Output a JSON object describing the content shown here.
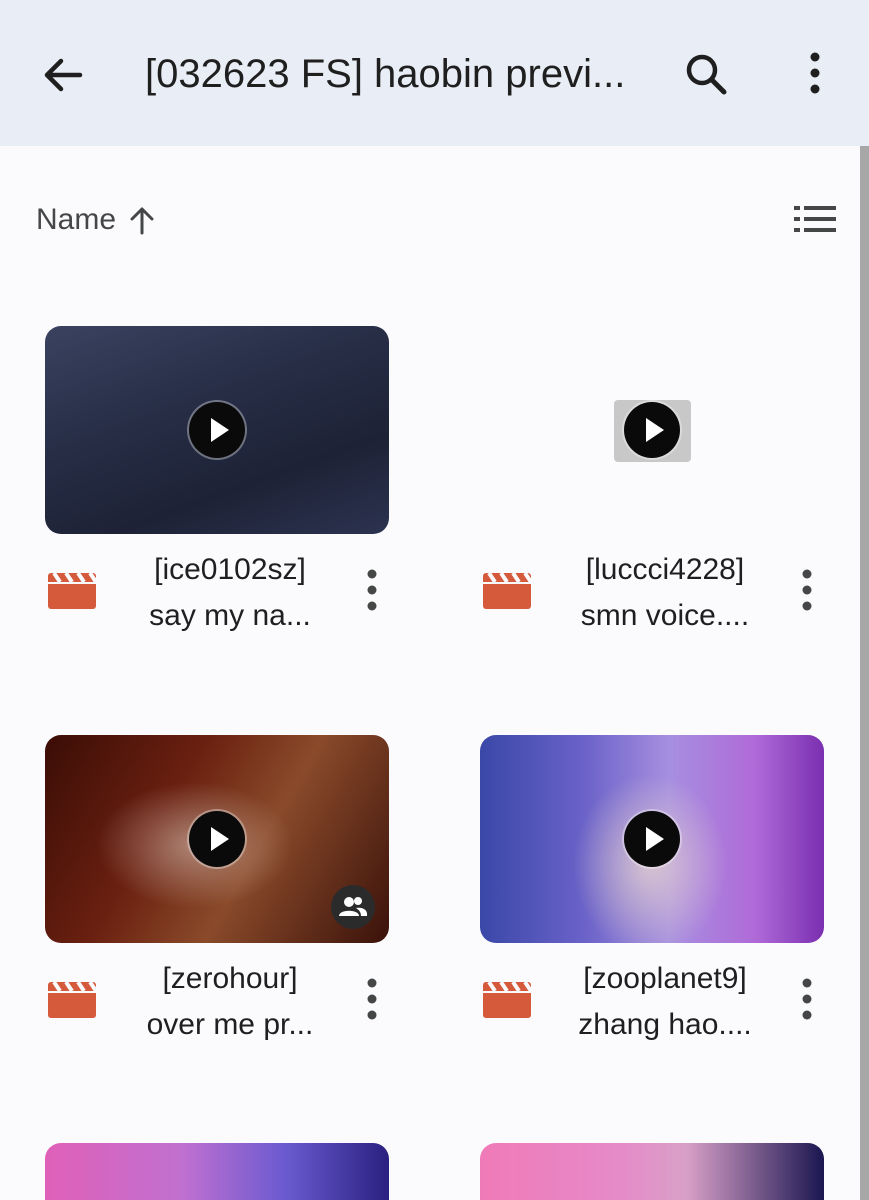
{
  "header": {
    "title": "[032623 FS] haobin previ...",
    "back_icon": "arrow-left-icon",
    "search_icon": "search-icon",
    "more_icon": "more-vert-icon",
    "background": "#e9eef6"
  },
  "sort": {
    "label": "Name",
    "direction_icon": "arrow-up-icon",
    "view_icon": "list-view-icon"
  },
  "files": [
    {
      "name_line1": "[ice0102sz]",
      "name_line2": "say my na...",
      "type_icon": "video-file-icon",
      "shared": false
    },
    {
      "name_line1": "[luccci4228]",
      "name_line2": "smn voice....",
      "type_icon": "video-file-icon",
      "shared": false
    },
    {
      "name_line1": "[zerohour]",
      "name_line2": "over me pr...",
      "type_icon": "video-file-icon",
      "shared": true
    },
    {
      "name_line1": "[zooplanet9]",
      "name_line2": "zhang hao....",
      "type_icon": "video-file-icon",
      "shared": false
    }
  ],
  "colors": {
    "video_icon": "#d55a3c",
    "page_bg": "#fbfbfe"
  }
}
